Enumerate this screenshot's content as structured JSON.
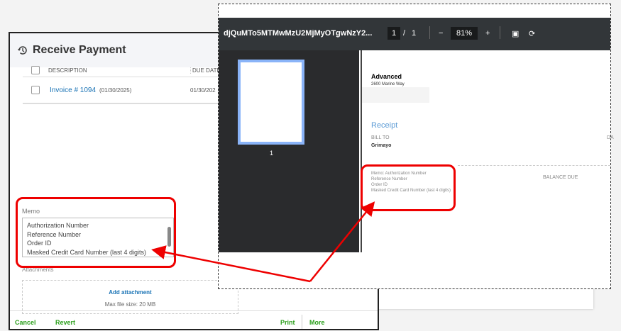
{
  "receive_payment": {
    "title": "Receive Payment",
    "columns": {
      "description": "DESCRIPTION",
      "due_date": "DUE DATE"
    },
    "rows": [
      {
        "invoice": "Invoice # 1094",
        "date": "(01/30/2025)",
        "due_date": "01/30/202"
      }
    ],
    "memo_label": "Memo",
    "memo_lines": [
      "Authorization Number",
      "Reference Number",
      "Order ID",
      "Masked Credit Card Number (last 4 digits)"
    ],
    "attachments_label": "Attachments",
    "add_attachment": "Add attachment",
    "max_file_size": "Max file size: 20 MB",
    "footer": {
      "cancel": "Cancel",
      "revert": "Revert",
      "print": "Print",
      "more": "More"
    }
  },
  "pdf_viewer": {
    "filename": "djQuMTo5MTMwMzU2MjMyOTgwNzY2...",
    "page_current": "1",
    "page_sep": "/",
    "page_total": "1",
    "zoom": "81%",
    "thumb_label": "1",
    "document": {
      "company": "Advanced",
      "address": "2600 Marine Way",
      "title": "Receipt",
      "bill_to_label": "BILL TO",
      "bill_to": "Grimayo",
      "date_label": "DA",
      "memo_lines": [
        "Memo: Authorization Number",
        "Reference Number",
        "Order ID",
        "Masked Credit Card Number (last 4 digits)"
      ],
      "balance_due_label": "BALANCE DUE"
    }
  },
  "colors": {
    "annotation": "#e00000",
    "link": "#1a73b5",
    "action": "#2ca01c"
  }
}
